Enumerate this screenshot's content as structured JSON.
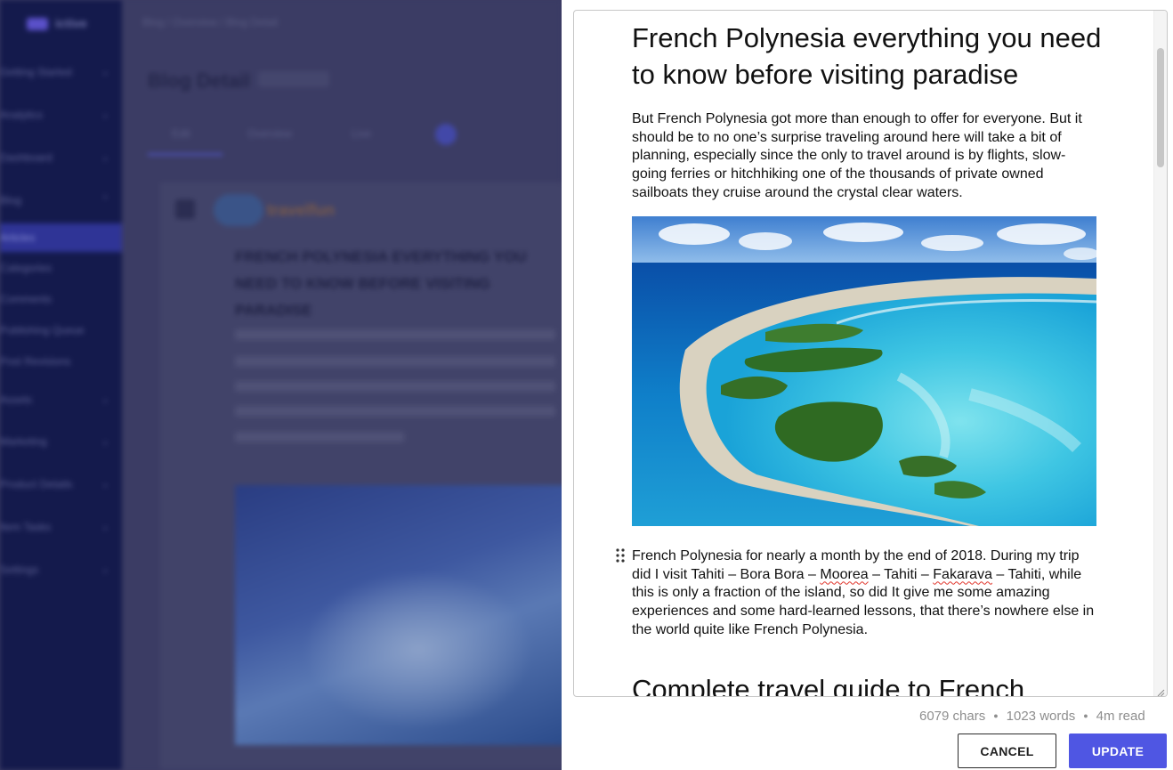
{
  "background": {
    "logo_text": "ictive",
    "nav_items": [
      "Getting Started",
      "Analytics",
      "Dashboard",
      "Blog",
      "Articles",
      "Categories",
      "Comments",
      "Publishing Queue",
      "Post Revisions",
      "Assets",
      "Marketing",
      "Product Details",
      "Item Tasks",
      "Settings"
    ],
    "breadcrumb": "Blog  /  Overview  /  Blog Detail",
    "page_title": "Blog Detail",
    "tabs": [
      "Edit",
      "Overview",
      "Live"
    ],
    "card_brand": "travelfun",
    "card_heading": "FRENCH POLYNESIA EVERYTHING YOU NEED TO KNOW BEFORE VISITING PARADISE"
  },
  "editor": {
    "title": "French Polynesia everything you need to know before visiting paradise",
    "intro": "But French Polynesia got more than enough to offer for everyone. But it should be to no one’s surprise traveling around here will take a bit of planning, especially since the only to travel around is by flights, slow-going ferries or hitchhiking one of the thousands of private owned sailboats they cruise around the crystal clear waters.",
    "para2": {
      "part1": "French Polynesia for nearly a month by the end of 2018. During my trip did I visit Tahiti – Bora Bora – ",
      "misspelled1": "Moorea",
      "part2": " – Tahiti – ",
      "misspelled2": "Fakarava",
      "part3": " – Tahiti, while this is only a fraction of the island, so did It give me some amazing experiences and some hard-learned lessons, that there’s nowhere else in the world quite like French Polynesia."
    },
    "next_heading": "Complete travel guide to French"
  },
  "stats": {
    "chars": "6079 chars",
    "words": "1023 words",
    "read": "4m read"
  },
  "actions": {
    "cancel_label": "CANCEL",
    "update_label": "UPDATE"
  },
  "colors": {
    "accent": "#4f56e3",
    "sidebar": "#141a4c",
    "overlay": "#3b3c64"
  }
}
